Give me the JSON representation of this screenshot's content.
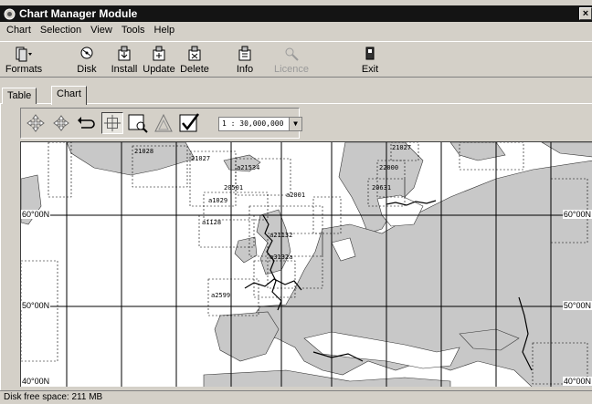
{
  "window": {
    "title": "Chart Manager Module",
    "close_glyph": "×"
  },
  "menu": [
    "Chart",
    "Selection",
    "View",
    "Tools",
    "Help"
  ],
  "toolbar": {
    "buttons": [
      {
        "label": "Formats",
        "icon": "formats-icon",
        "enabled": true
      },
      {
        "label": "Disk",
        "icon": "disk-icon",
        "enabled": true
      },
      {
        "label": "Install",
        "icon": "install-icon",
        "enabled": true
      },
      {
        "label": "Update",
        "icon": "update-icon",
        "enabled": true
      },
      {
        "label": "Delete",
        "icon": "delete-icon",
        "enabled": true
      },
      {
        "label": "Info",
        "icon": "info-icon",
        "enabled": true
      },
      {
        "label": "Licence",
        "icon": "licence-icon",
        "enabled": false
      },
      {
        "label": "Exit",
        "icon": "exit-icon",
        "enabled": true
      }
    ]
  },
  "tabs": {
    "table": "Table",
    "chart": "Chart",
    "active": "Chart"
  },
  "chart_tools": {
    "icons": [
      "pan-icon",
      "zoom-move-icon",
      "undo-icon",
      "crosshair-icon",
      "zoom-window-icon",
      "triangle-icon",
      "checkmark-icon"
    ],
    "scale_value": "1 : 30,000,000"
  },
  "map": {
    "lat_labels": {
      "left_60": "60°00N",
      "right_60": "60°00N",
      "left_50": "50°00N",
      "right_50": "50°00N",
      "left_40": "40°00N",
      "right_40": "40°00N"
    },
    "chart_ids": [
      "21028",
      "21027",
      "a21534",
      "20501",
      "a1029",
      "a2001",
      "21027",
      "22000",
      "20631",
      "a1128",
      "a21132",
      "a3132a",
      "a2599"
    ],
    "land_color": "#c8c8c8",
    "sea_color": "#ffffff"
  },
  "status": {
    "text": "Disk free space: 211 MB"
  }
}
